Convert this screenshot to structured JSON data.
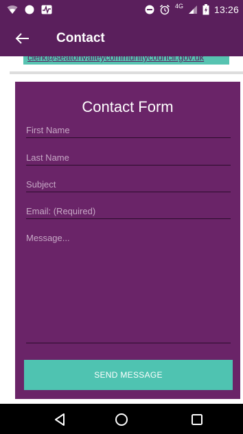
{
  "status_bar": {
    "time": "13:26",
    "network": "4G"
  },
  "app_bar": {
    "title": "Contact"
  },
  "email_strip": {
    "email": "clerk@seatonvalleycommunitycouncil.gov.uk"
  },
  "form": {
    "title": "Contact Form",
    "first_name_placeholder": "First Name",
    "first_name_value": "",
    "last_name_placeholder": "Last Name",
    "last_name_value": "",
    "subject_placeholder": "Subject",
    "subject_value": "",
    "email_placeholder": "Email: (Required)",
    "email_value": "",
    "message_placeholder": "Message...",
    "message_value": "",
    "send_label": "SEND MESSAGE"
  },
  "colors": {
    "primary": "#5a1f5c",
    "card": "#6a2468",
    "accent": "#4fc3b1"
  },
  "icons": {
    "status_left": [
      "wifi-icon",
      "circle-icon",
      "activity-icon"
    ],
    "status_right": [
      "do-not-disturb-icon",
      "alarm-icon",
      "signal-icon",
      "battery-icon"
    ],
    "navigation": [
      "back-triangle-icon",
      "home-circle-icon",
      "recent-square-icon"
    ]
  }
}
